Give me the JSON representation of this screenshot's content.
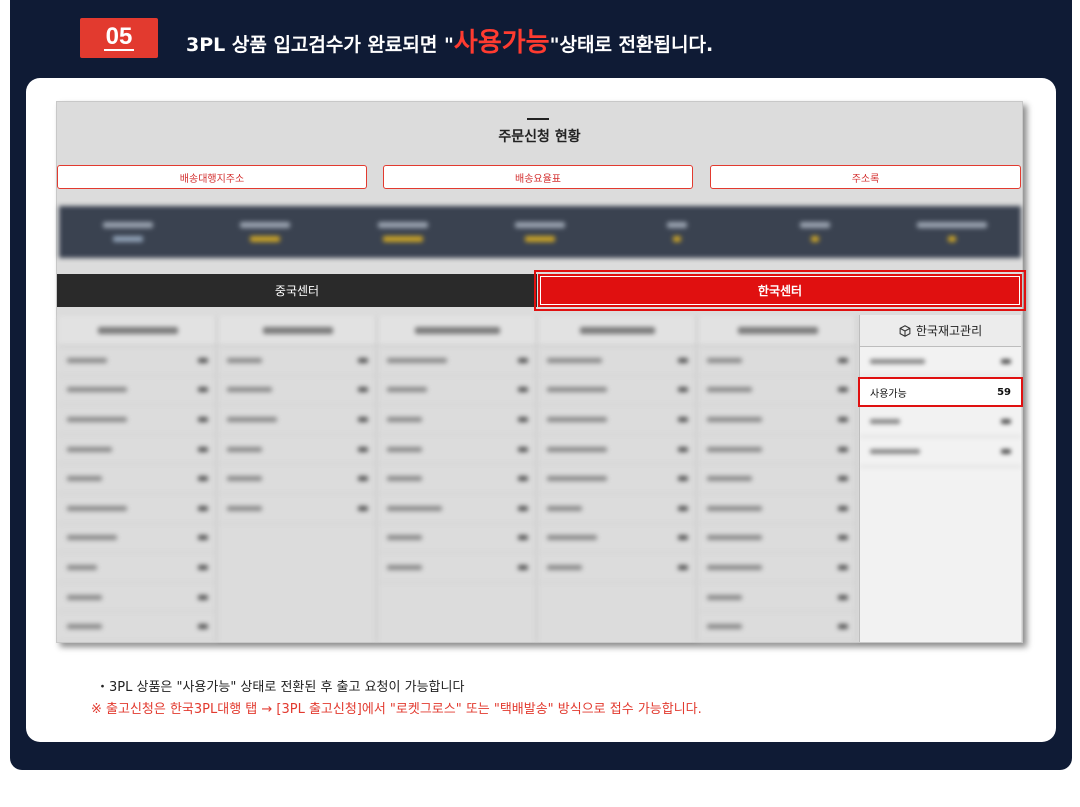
{
  "step": {
    "number": "05"
  },
  "headline": {
    "prefix": "3PL 상품 입고검수가 완료되면 \"",
    "highlight": "사용가능",
    "suffix": "\"상태로 전환됩니다."
  },
  "screen": {
    "title": "주문신청 현황",
    "links": [
      {
        "label": "배송대행지주소"
      },
      {
        "label": "배송요율표"
      },
      {
        "label": "주소록"
      }
    ],
    "tabs": [
      {
        "label": "중국센터",
        "active": false
      },
      {
        "label": "한국센터",
        "active": true
      }
    ],
    "inventory_panel": {
      "title": "한국재고관리",
      "highlight_row": {
        "label": "사용가능",
        "value": "59"
      }
    }
  },
  "notes": {
    "line1": "・3PL 상품은 \"사용가능\" 상태로 전환된 후 출고 요청이 가능합니다",
    "line2": "※ 출고신청은 한국3PL대행 탭 → [3PL 출고신청]에서 \"로켓그로스\" 또는 \"택배발송\" 방식으로 접수 가능합니다."
  },
  "colors": {
    "frame": "#0f1b35",
    "accent_red": "#e23a2f",
    "tab_active": "#e01010",
    "tab_inactive": "#2a2a2a"
  },
  "icons": {
    "inventory": "box-icon"
  }
}
